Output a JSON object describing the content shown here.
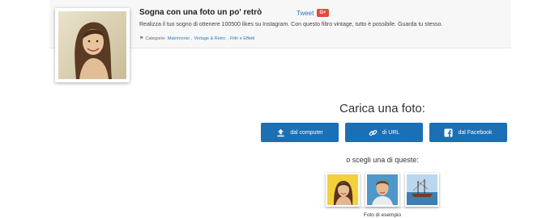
{
  "effect": {
    "title": "Sogna con una foto un po' retrò",
    "description": "Realizza il tuo sogno di ottenere 100500 likes su Instagram. Con questo filtro vintage, tutto è possibile. Guarda tu stesso.",
    "categories_label": "Categorie:",
    "categories": [
      "Matrimonio",
      "Vintage & Retro",
      "Filtri e Effetti"
    ],
    "tweet_label": "Tweet",
    "gplus_label": "G+"
  },
  "upload": {
    "title": "Carica una foto:",
    "buttons": [
      {
        "label": "dal computer",
        "icon": "upload-icon"
      },
      {
        "label": "di URL",
        "icon": "link-icon"
      },
      {
        "label": "dal Facebook",
        "icon": "facebook-icon"
      }
    ],
    "choose_label": "o scegli una di queste:",
    "samples_caption": "Foto di esempio"
  },
  "colors": {
    "button": "#1b6fb5",
    "link": "#2a7ab8",
    "gplus": "#dd4b39"
  }
}
